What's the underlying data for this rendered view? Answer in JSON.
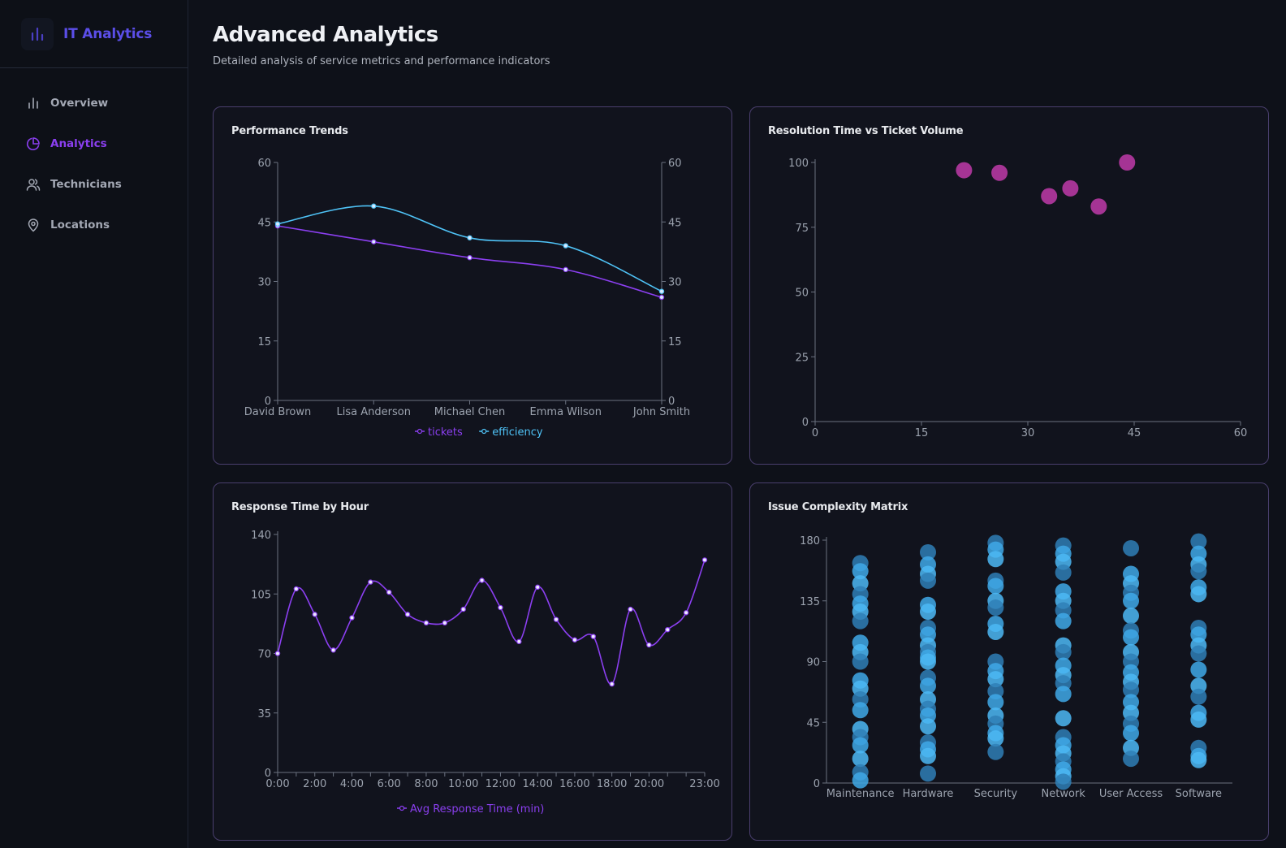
{
  "app": {
    "brand": "IT Analytics"
  },
  "sidebar": {
    "items": [
      {
        "label": "Overview",
        "icon": "bar-chart-icon",
        "active": false
      },
      {
        "label": "Analytics",
        "icon": "pie-chart-icon",
        "active": true
      },
      {
        "label": "Technicians",
        "icon": "users-icon",
        "active": false
      },
      {
        "label": "Locations",
        "icon": "map-pin-icon",
        "active": false
      }
    ]
  },
  "header": {
    "title": "Advanced Analytics",
    "subtitle": "Detailed analysis of service metrics and performance indicators"
  },
  "colors": {
    "purple": "#8b3ff0",
    "cyan": "#4fc3f7",
    "magenta": "#b2379e",
    "blue": "#3fa9e8"
  },
  "chart_data": [
    {
      "id": "performance",
      "type": "line",
      "title": "Performance Trends",
      "categories": [
        "David Brown",
        "Lisa Anderson",
        "Michael Chen",
        "Emma Wilson",
        "John Smith"
      ],
      "series": [
        {
          "name": "tickets",
          "color": "#8b3ff0",
          "values": [
            44,
            40,
            36,
            33,
            26
          ]
        },
        {
          "name": "efficiency",
          "color": "#4fc3f7",
          "values": [
            44.5,
            49,
            41,
            39,
            27.5
          ]
        }
      ],
      "ylim": [
        0,
        60
      ],
      "yticks": [
        "0",
        "15",
        "30",
        "45",
        "60"
      ],
      "dual_axis": true,
      "legend": "bottom"
    },
    {
      "id": "resolution",
      "type": "scatter",
      "title": "Resolution Time vs Ticket Volume",
      "points": [
        [
          21,
          97
        ],
        [
          26,
          96
        ],
        [
          33,
          87
        ],
        [
          36,
          90
        ],
        [
          40,
          83
        ],
        [
          44,
          100
        ]
      ],
      "xlim": [
        0,
        60
      ],
      "ylim": [
        0,
        100
      ],
      "xticks": [
        "0",
        "15",
        "30",
        "45",
        "60"
      ],
      "yticks": [
        "0",
        "25",
        "50",
        "75",
        "100"
      ],
      "color": "#b2379e"
    },
    {
      "id": "response",
      "type": "line",
      "title": "Response Time by Hour",
      "x": [
        0,
        1,
        2,
        3,
        4,
        5,
        6,
        7,
        8,
        9,
        10,
        11,
        12,
        13,
        14,
        15,
        16,
        17,
        18,
        19,
        20,
        21,
        22,
        23
      ],
      "xticks": [
        "0:00",
        "2:00",
        "4:00",
        "6:00",
        "8:00",
        "10:00",
        "12:00",
        "14:00",
        "16:00",
        "18:00",
        "20:00",
        "23:00"
      ],
      "series": [
        {
          "name": "Avg Response Time (min)",
          "color": "#8b3ff0",
          "values": [
            70,
            108,
            93,
            72,
            91,
            112,
            106,
            93,
            88,
            88,
            96,
            113,
            97,
            77,
            109,
            90,
            78,
            80,
            52,
            96,
            75,
            84,
            94,
            125
          ]
        }
      ],
      "ylim": [
        0,
        140
      ],
      "yticks": [
        "0",
        "35",
        "70",
        "105",
        "140"
      ],
      "legend": "bottom"
    },
    {
      "id": "complexity",
      "type": "scatter",
      "title": "Issue Complexity Matrix",
      "categories": [
        "Maintenance",
        "Hardware",
        "Security",
        "Network",
        "User Access",
        "Software"
      ],
      "ylim": [
        0,
        180
      ],
      "yticks": [
        "0",
        "45",
        "90",
        "135",
        "180"
      ],
      "color": "#3fa9e8",
      "points": {
        "Maintenance": [
          163,
          157,
          148,
          140,
          133,
          127,
          120,
          104,
          97,
          90,
          76,
          70,
          62,
          54,
          40,
          34,
          28,
          18,
          8,
          2
        ],
        "Hardware": [
          171,
          162,
          155,
          150,
          132,
          127,
          115,
          110,
          102,
          97,
          93,
          90,
          78,
          72,
          62,
          55,
          50,
          42,
          30,
          25,
          20,
          7
        ],
        "Security": [
          178,
          173,
          166,
          150,
          146,
          135,
          130,
          118,
          112,
          90,
          83,
          77,
          68,
          60,
          50,
          44,
          37,
          33,
          23
        ],
        "Network": [
          176,
          170,
          164,
          156,
          142,
          135,
          128,
          120,
          102,
          97,
          87,
          80,
          74,
          66,
          48,
          34,
          28,
          22,
          16,
          10,
          5,
          1
        ],
        "User Access": [
          174,
          155,
          148,
          141,
          135,
          124,
          113,
          108,
          97,
          90,
          82,
          75,
          69,
          60,
          52,
          44,
          37,
          26,
          18
        ],
        "Software": [
          179,
          170,
          162,
          157,
          145,
          140,
          115,
          110,
          102,
          96,
          84,
          72,
          64,
          52,
          47,
          26,
          20,
          17
        ]
      }
    }
  ]
}
